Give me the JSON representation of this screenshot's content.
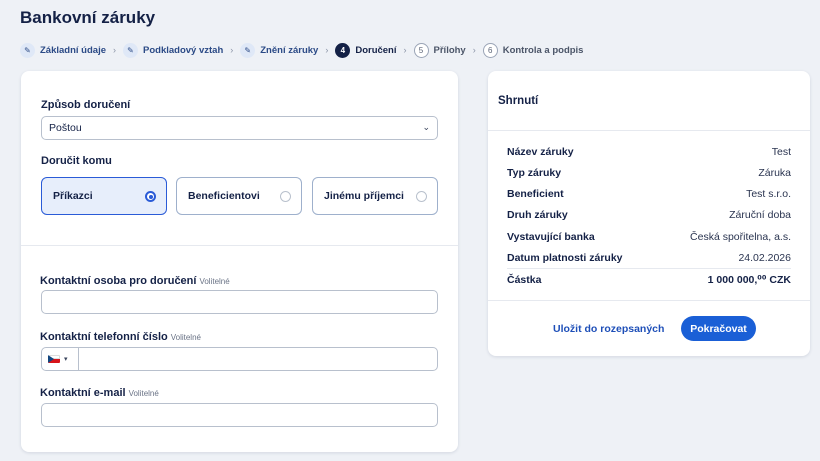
{
  "page": {
    "title": "Bankovní záruky"
  },
  "stepper": {
    "steps": [
      {
        "number": "",
        "label": "Základní údaje",
        "state": "done"
      },
      {
        "number": "",
        "label": "Podkladový vztah",
        "state": "done"
      },
      {
        "number": "",
        "label": "Znění záruky",
        "state": "done"
      },
      {
        "number": "4",
        "label": "Doručení",
        "state": "active"
      },
      {
        "number": "5",
        "label": "Přílohy",
        "state": "todo"
      },
      {
        "number": "6",
        "label": "Kontrola a podpis",
        "state": "todo"
      }
    ],
    "done_icon": "pencil-icon",
    "separator": "›"
  },
  "delivery": {
    "method_label": "Způsob doručení",
    "method_value": "Poštou",
    "recipient_label": "Doručit komu",
    "recipient_options": [
      "Příkazci",
      "Beneficientovi",
      "Jinému příjemci"
    ],
    "recipient_selected": "Příkazci",
    "contact_person_label": "Kontaktní osoba pro doručení",
    "phone_label": "Kontaktní telefonní číslo",
    "email_label": "Kontaktní e-mail",
    "optional": "Volitelné",
    "contact_person_value": "",
    "phone_value": "",
    "email_value": ""
  },
  "summary": {
    "title": "Shrnutí",
    "rows": [
      {
        "key": "Název záruky",
        "value": "Test"
      },
      {
        "key": "Typ záruky",
        "value": "Záruka"
      },
      {
        "key": "Beneficient",
        "value": "Test s.r.o."
      },
      {
        "key": "Druh záruky",
        "value": "Záruční doba"
      },
      {
        "key": "Vystavující banka",
        "value": "Česká spořitelna, a.s."
      },
      {
        "key": "Datum platnosti záruky",
        "value": "24.02.2026"
      }
    ],
    "total": {
      "key": "Částka",
      "value": "1 000 000,⁰⁰ CZK"
    },
    "save_label": "Uložit do rozepsaných",
    "continue_label": "Pokračovat"
  },
  "colors": {
    "accent": "#1a5fd6",
    "navy": "#142146",
    "background": "#eef1f6"
  }
}
